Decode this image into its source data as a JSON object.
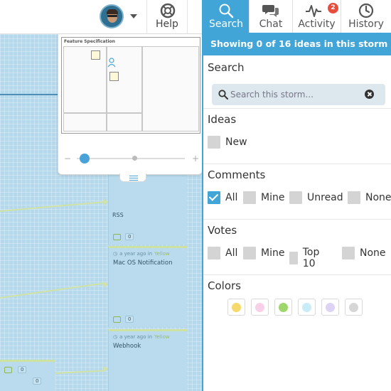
{
  "topbar": {
    "help_label": "Help"
  },
  "canvas": {
    "cards": [
      {
        "title": "RSS",
        "count": "0"
      },
      {
        "time": "a year ago in",
        "source": "Yellow",
        "title": "Mac OS Notification",
        "count": "0"
      },
      {
        "time": "a year ago in",
        "source": "Yellow",
        "title": "Webhook",
        "count": "0"
      }
    ],
    "bottom_card_counts": [
      "0",
      "0"
    ]
  },
  "minimap": {
    "title": "Feature Specification",
    "zoom": {
      "level": 0.05
    }
  },
  "panel": {
    "tabs": [
      {
        "label": "Search",
        "icon": "search-icon",
        "active": true
      },
      {
        "label": "Chat",
        "icon": "chat-icon",
        "active": false
      },
      {
        "label": "Activity",
        "icon": "activity-icon",
        "active": false,
        "badge": "2"
      },
      {
        "label": "History",
        "icon": "clock-icon",
        "active": false
      }
    ],
    "status": "Showing 0 of 16 ideas in this storm",
    "search": {
      "title": "Search",
      "placeholder": "Search this storm..."
    },
    "ideas": {
      "title": "Ideas",
      "options": [
        {
          "label": "New",
          "checked": false
        }
      ]
    },
    "comments": {
      "title": "Comments",
      "options": [
        {
          "label": "All",
          "checked": true
        },
        {
          "label": "Mine",
          "checked": false
        },
        {
          "label": "Unread",
          "checked": false
        },
        {
          "label": "None",
          "checked": false
        }
      ]
    },
    "votes": {
      "title": "Votes",
      "options": [
        {
          "label": "All",
          "checked": false
        },
        {
          "label": "Mine",
          "checked": false
        },
        {
          "label": "Top 10",
          "checked": false
        },
        {
          "label": "None",
          "checked": false
        }
      ]
    },
    "colors": {
      "title": "Colors",
      "swatches": [
        "#f6d96b",
        "#f8d0e8",
        "#9fd66b",
        "#c8ecf8",
        "#ddd3f5",
        "#d6d6d6"
      ]
    }
  }
}
